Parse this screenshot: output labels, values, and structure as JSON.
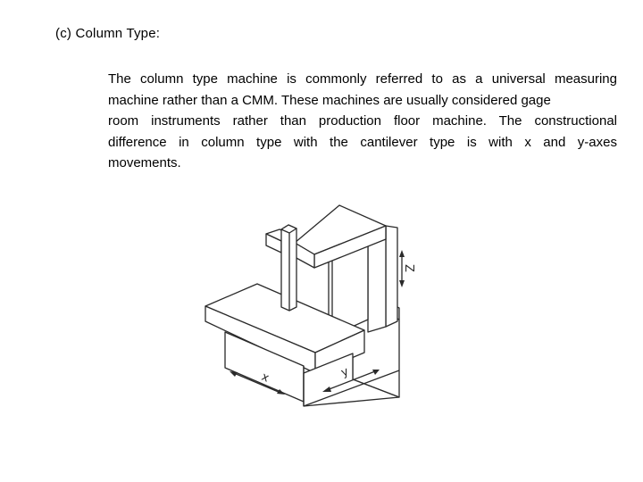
{
  "section": {
    "heading": "(c) Column Type:"
  },
  "paragraph": {
    "lines": [
      "The column type machine is commonly referred to as a universal measuring",
      "machine rather than a CMM. These machines are usually considered gage",
      "room instruments rather than production floor machine. The constructional",
      "difference in column type with the cantilever type is with x and y-axes",
      "movements."
    ]
  },
  "figure": {
    "description": "Isometric sketch of a column type measuring machine",
    "axis_labels": {
      "x": "x",
      "y": "y",
      "z": "Z"
    }
  }
}
